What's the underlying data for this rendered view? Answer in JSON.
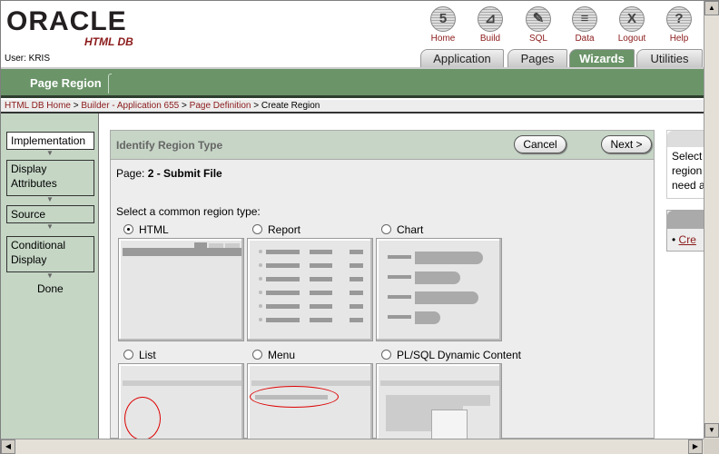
{
  "logo": {
    "brand": "ORACLE",
    "product": "HTML DB"
  },
  "nav": [
    {
      "label": "Home",
      "icon": "home-icon",
      "glyph": "5"
    },
    {
      "label": "Build",
      "icon": "build-icon",
      "glyph": "⊿"
    },
    {
      "label": "SQL",
      "icon": "sql-icon",
      "glyph": "✎"
    },
    {
      "label": "Data",
      "icon": "data-icon",
      "glyph": "≡"
    },
    {
      "label": "Logout",
      "icon": "logout-icon",
      "glyph": "X"
    },
    {
      "label": "Help",
      "icon": "help-icon",
      "glyph": "?"
    }
  ],
  "user": "User: KRIS",
  "tabs": [
    {
      "label": "Application"
    },
    {
      "label": "Pages"
    },
    {
      "label": "Wizards",
      "active": true
    },
    {
      "label": "Utilities"
    }
  ],
  "page_title": "Page Region",
  "breadcrumb": {
    "links": [
      "HTML DB Home",
      "Builder - Application 655",
      "Page Definition"
    ],
    "current": "Create Region",
    "sep": " > "
  },
  "steps": [
    {
      "label": "Implementation",
      "current": true
    },
    {
      "label": "Display Attributes"
    },
    {
      "label": "Source"
    },
    {
      "label": "Conditional Display"
    },
    {
      "label": "Done"
    }
  ],
  "region": {
    "title": "Identify Region Type",
    "cancel": "Cancel",
    "next": "Next >",
    "page_label": "Page:",
    "page_value": "2 - Submit File",
    "prompt": "Select a common region type:"
  },
  "types": [
    {
      "label": "HTML",
      "selected": true
    },
    {
      "label": "Report"
    },
    {
      "label": "Chart"
    },
    {
      "label": "List"
    },
    {
      "label": "Menu"
    },
    {
      "label": "PL/SQL Dynamic Content"
    }
  ],
  "right": {
    "help_text": [
      "Select",
      "region",
      "need a"
    ],
    "link": "Cre"
  },
  "colors": {
    "accent_green": "#6b9469",
    "link_red": "#8b1a1a",
    "panel_green": "#c5d6c5"
  }
}
